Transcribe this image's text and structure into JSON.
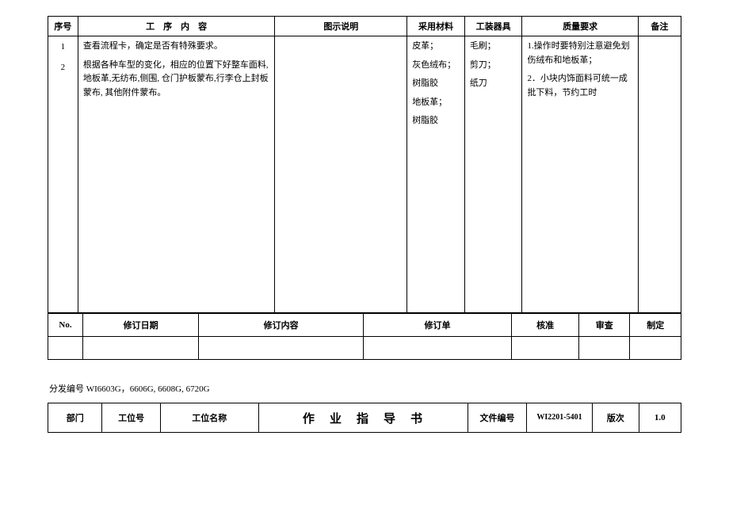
{
  "main_table": {
    "headers": {
      "seq": "序号",
      "content": "工　序　内　容",
      "diagram": "图示说明",
      "material": "采用材料",
      "tool": "工装器具",
      "quality": "质量要求",
      "note": "备注"
    },
    "rows": [
      {
        "seq": "1",
        "content": "查看流程卡，确定是否有特殊要求。"
      },
      {
        "seq": "2",
        "content": "根据各种车型的变化，相应的位置下好整车面料,地板革,无纺布,侧围, 仓门护板蒙布,行李仓上封板蒙布, 其他附件蒙布。"
      }
    ],
    "material_list": [
      "皮革；",
      "灰色绒布；",
      "树脂胶",
      "地板革；",
      "树脂胶"
    ],
    "tool_list": [
      "毛刷；",
      "剪刀；",
      "纸刀"
    ],
    "quality_list": [
      "1.操作时要特别注意避免划伤绒布和地板革；",
      "2．小块内饰面料可统一成批下料，节约工时"
    ]
  },
  "revision_table": {
    "headers": {
      "no": "No.",
      "date": "修订日期",
      "content": "修订内容",
      "unit": "修订单",
      "check": "核准",
      "review": "审查",
      "make": "制定"
    }
  },
  "distribution": "分发编号 WI6603G，6606G, 6608G, 6720G",
  "footer": {
    "dept": "部门",
    "pos": "工位号",
    "posname": "工位名称",
    "title": "作　业　指　导　书",
    "docno_label": "文件编号",
    "docno": "WI2201-5401",
    "rev_label": "版次",
    "rev_no": "1.0"
  }
}
